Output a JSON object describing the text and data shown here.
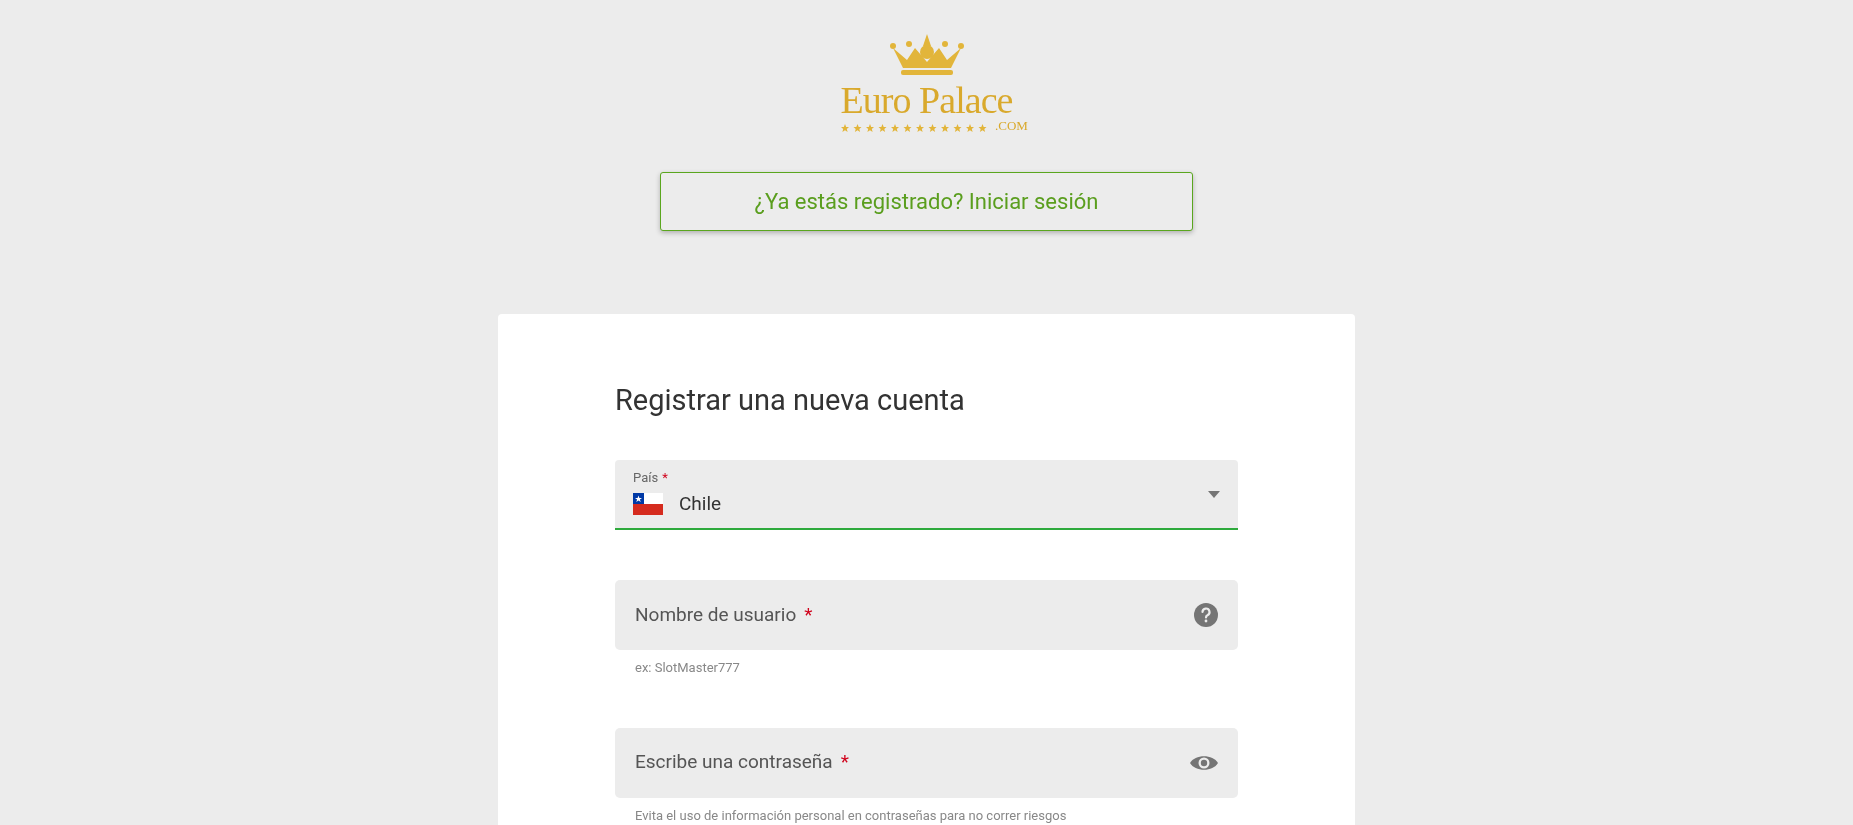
{
  "logo": {
    "name": "Euro Palace",
    "domain": ".COM"
  },
  "login_prompt": {
    "label": "¿Ya estás registrado? Iniciar sesión"
  },
  "form": {
    "title": "Registrar una nueva cuenta",
    "fields": [
      {
        "kind": "select",
        "label": "País",
        "required_mark": "*",
        "value": "Chile",
        "focused": true
      },
      {
        "kind": "text",
        "label": "Nombre de usuario",
        "required_mark": "*",
        "helper": "ex: SlotMaster777",
        "focused": false
      },
      {
        "kind": "password",
        "label": "Escribe una contraseña",
        "required_mark": "*",
        "helper": "Evita el uso de información personal en contraseñas para no correr riesgos",
        "focused": false
      }
    ]
  }
}
